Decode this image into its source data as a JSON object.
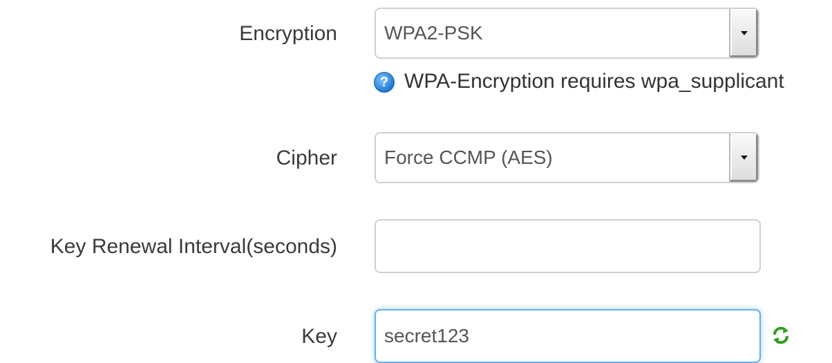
{
  "encryption": {
    "label": "Encryption",
    "selected": "WPA2-PSK",
    "help_text": "WPA-Encryption requires wpa_supplicant"
  },
  "cipher": {
    "label": "Cipher",
    "selected": "Force CCMP (AES)"
  },
  "key_renewal": {
    "label": "Key Renewal Interval(seconds)",
    "value": ""
  },
  "key": {
    "label": "Key",
    "value": "secret123"
  },
  "icons": {
    "help": "help-icon",
    "select_arrow": "chevron-down-icon",
    "refresh": "refresh-icon"
  },
  "colors": {
    "focus_border": "#66afe9",
    "help_icon": "#1f78d1",
    "refresh_icon": "#33a020"
  }
}
